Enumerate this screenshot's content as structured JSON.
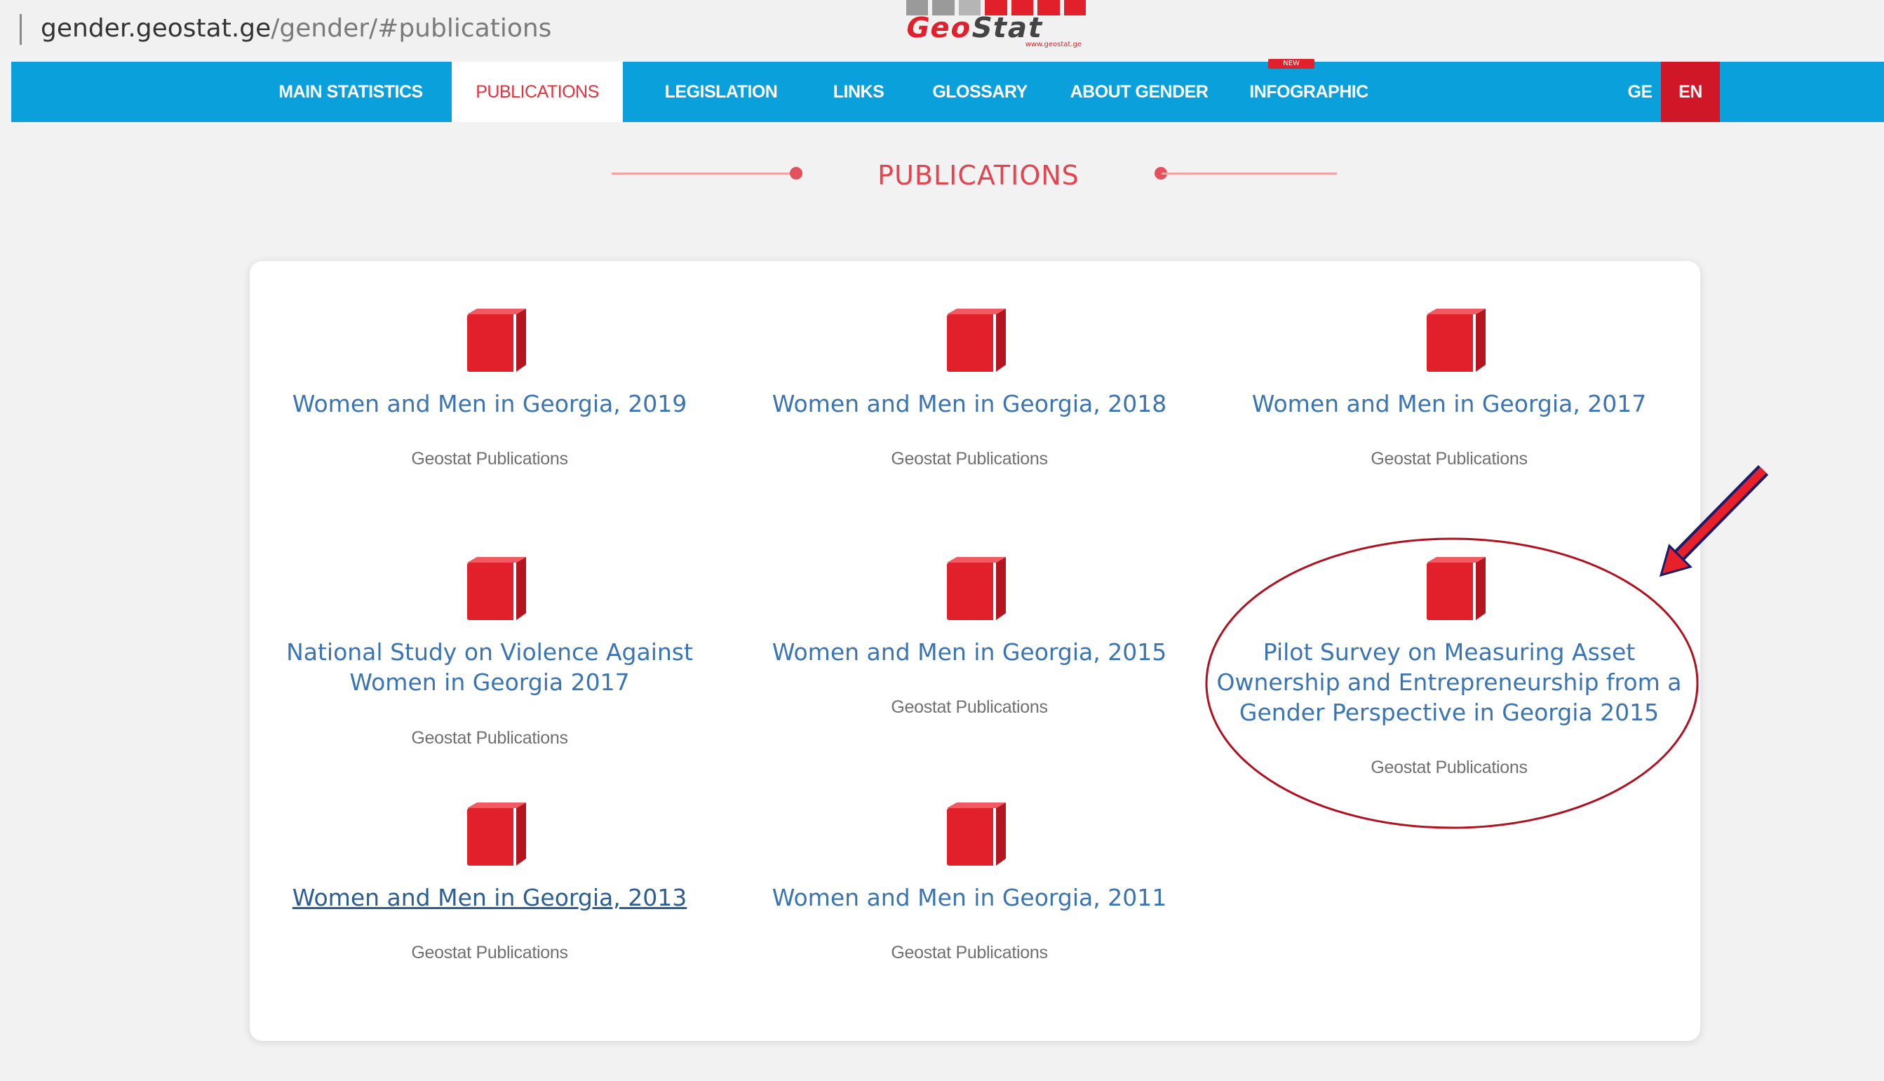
{
  "browser": {
    "url_host": "gender.geostat.ge",
    "url_path": "/gender/#publications"
  },
  "logo": {
    "text_geo": "Geo",
    "text_stat": "Stat",
    "subtext": "www.geostat.ge",
    "bar_colors": [
      "#9a9a9a",
      "#9a9a9a",
      "#b5b5b5",
      "#e1202b",
      "#e1202b",
      "#e1202b",
      "#e1202b"
    ]
  },
  "nav": {
    "items": [
      {
        "label": "MAIN STATISTICS"
      },
      {
        "label": "PUBLICATIONS",
        "active": true
      },
      {
        "label": "LEGISLATION"
      },
      {
        "label": "LINKS"
      },
      {
        "label": "GLOSSARY"
      },
      {
        "label": "ABOUT GENDER"
      },
      {
        "label": "INFOGRAPHIC"
      }
    ],
    "new_badge": "NEW",
    "lang_ge": "GE",
    "lang_en": "EN"
  },
  "section": {
    "title": "PUBLICATIONS"
  },
  "publications": [
    {
      "title": "Women and Men in Georgia, 2019",
      "publisher": "Geostat Publications"
    },
    {
      "title": "Women and Men in Georgia, 2018",
      "publisher": "Geostat Publications"
    },
    {
      "title": "Women and Men in Georgia, 2017",
      "publisher": "Geostat Publications"
    },
    {
      "title_lines": [
        "National Study on Violence Against",
        "Women in Georgia 2017"
      ],
      "publisher": "Geostat Publications"
    },
    {
      "title": "Women and Men in Georgia, 2015",
      "publisher": "Geostat Publications"
    },
    {
      "title_lines": [
        "Pilot Survey on Measuring Asset",
        "Ownership and Entrepreneurship from a",
        "Gender Perspective in Georgia 2015"
      ],
      "publisher": "Geostat Publications"
    },
    {
      "title": "Women and Men in Georgia, 2013",
      "publisher": "Geostat Publications"
    },
    {
      "title": "Women and Men in Georgia, 2011",
      "publisher": "Geostat Publications"
    }
  ],
  "colors": {
    "nav_bg": "#0aa0dc",
    "accent_red": "#e1202b",
    "link_blue": "#3a74b3",
    "annotation_red": "#b01020"
  },
  "icons": {
    "book": "book-icon",
    "annotation_arrow": "arrow-icon"
  }
}
